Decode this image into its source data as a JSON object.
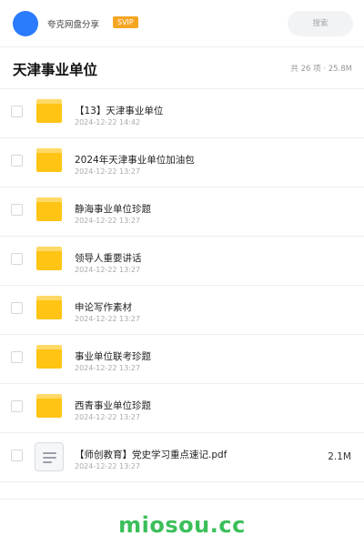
{
  "header": {
    "username": "夸克网盘分享",
    "badge": "SVIP",
    "search_placeholder": "搜索",
    "avatar_color": "#2b7bff",
    "badge_color": "#f5a623"
  },
  "folder": {
    "title": "天津事业单位",
    "meta": "共 26 项 · 25.8M"
  },
  "files": [
    {
      "icon": "folder-icon",
      "name": "【13】天津事业单位",
      "date": "2024-12-22 14:42",
      "size": ""
    },
    {
      "icon": "folder-icon",
      "name": "2024年天津事业单位加油包",
      "date": "2024-12-22 13:27",
      "size": ""
    },
    {
      "icon": "folder-icon",
      "name": "静海事业单位珍题",
      "date": "2024-12-22 13:27",
      "size": ""
    },
    {
      "icon": "folder-icon",
      "name": "领导人重要讲话",
      "date": "2024-12-22 13:27",
      "size": ""
    },
    {
      "icon": "folder-icon",
      "name": "申论写作素材",
      "date": "2024-12-22 13:27",
      "size": ""
    },
    {
      "icon": "folder-icon",
      "name": "事业单位联考珍题",
      "date": "2024-12-22 13:27",
      "size": ""
    },
    {
      "icon": "folder-icon",
      "name": "西青事业单位珍题",
      "date": "2024-12-22 13:27",
      "size": ""
    },
    {
      "icon": "document-icon",
      "name": "【师创教育】党史学习重点速记.pdf",
      "date": "2024-12-22 13:27",
      "size": "2.1M"
    }
  ],
  "footer": {
    "watermark": "miosou.cc",
    "watermark_color": "#3cbf5a"
  }
}
